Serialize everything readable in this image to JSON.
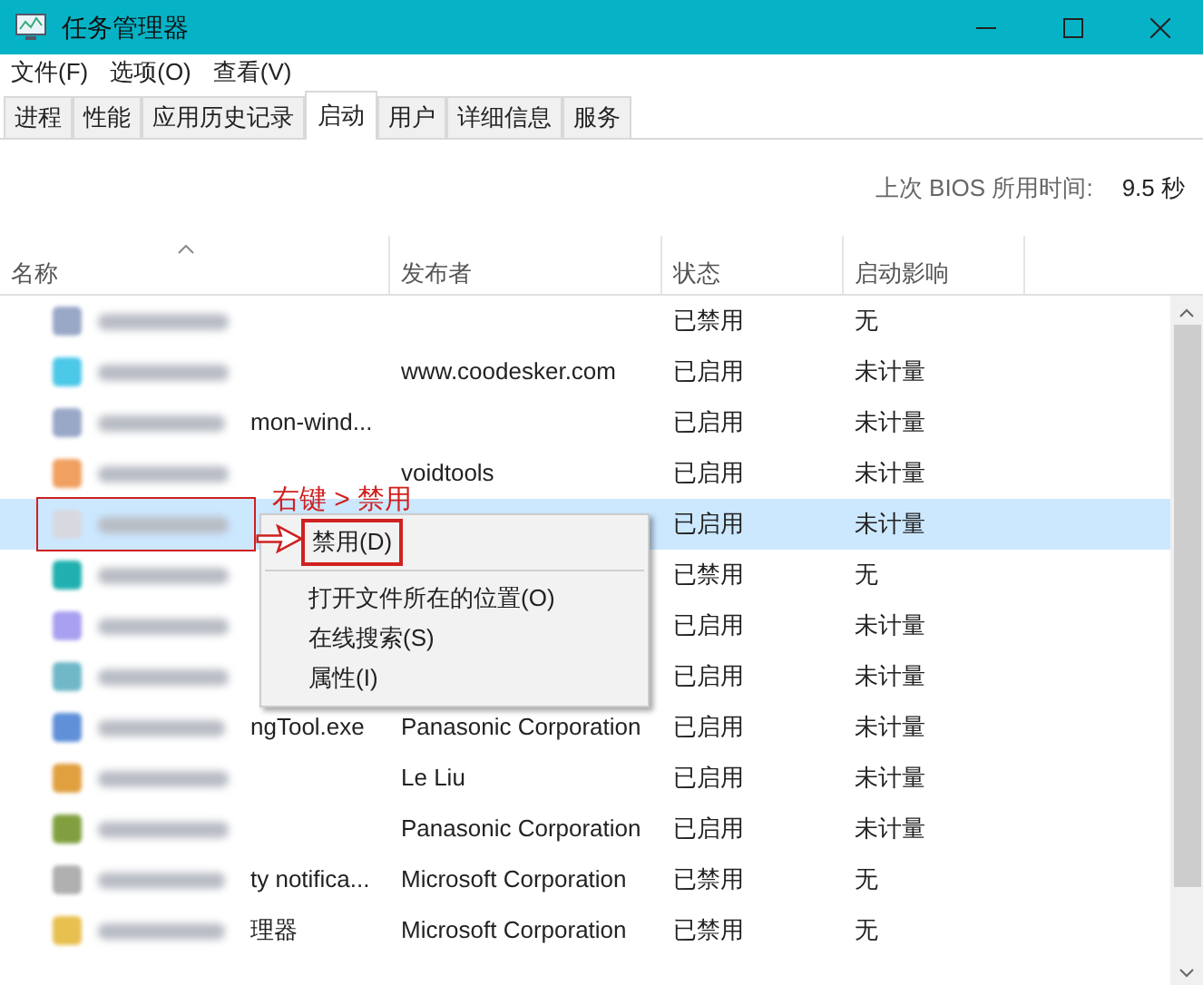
{
  "window": {
    "title": "任务管理器"
  },
  "menu": [
    "文件(F)",
    "选项(O)",
    "查看(V)"
  ],
  "tabs": [
    {
      "label": "进程",
      "selected": false
    },
    {
      "label": "性能",
      "selected": false
    },
    {
      "label": "应用历史记录",
      "selected": false
    },
    {
      "label": "启动",
      "selected": true
    },
    {
      "label": "用户",
      "selected": false
    },
    {
      "label": "详细信息",
      "selected": false
    },
    {
      "label": "服务",
      "selected": false
    }
  ],
  "bios": {
    "label": "上次 BIOS 所用时间:",
    "value": "9.5 秒"
  },
  "table": {
    "columns": [
      "名称",
      "发布者",
      "状态",
      "启动影响"
    ],
    "rows": [
      {
        "color": "#9aa8c8",
        "name_tail": "",
        "publisher": "",
        "status": "已禁用",
        "impact": "无",
        "selected": false
      },
      {
        "color": "#4cc8e8",
        "name_tail": "",
        "publisher": "www.coodesker.com",
        "status": "已启用",
        "impact": "未计量",
        "selected": false
      },
      {
        "color": "#9aa8c8",
        "name_tail": "mon-wind...",
        "publisher": "",
        "status": "已启用",
        "impact": "未计量",
        "selected": false
      },
      {
        "color": "#f0a060",
        "name_tail": "",
        "publisher": "voidtools",
        "status": "已启用",
        "impact": "未计量",
        "selected": false
      },
      {
        "color": "#d8d8e0",
        "name_tail": "",
        "publisher": "",
        "status": "已启用",
        "impact": "未计量",
        "selected": true
      },
      {
        "color": "#20b0b0",
        "name_tail": "",
        "publisher": "",
        "status": "已禁用",
        "impact": "无",
        "selected": false
      },
      {
        "color": "#a8a0f0",
        "name_tail": "",
        "publisher": "",
        "status": "已启用",
        "impact": "未计量",
        "selected": false
      },
      {
        "color": "#70b8c8",
        "name_tail": "",
        "publisher": "",
        "status": "已启用",
        "impact": "未计量",
        "selected": false
      },
      {
        "color": "#6090d8",
        "name_tail": "ngTool.exe",
        "publisher": "Panasonic Corporation",
        "status": "已启用",
        "impact": "未计量",
        "selected": false
      },
      {
        "color": "#e0a040",
        "name_tail": "",
        "publisher": "Le Liu",
        "status": "已启用",
        "impact": "未计量",
        "selected": false
      },
      {
        "color": "#80a040",
        "name_tail": "",
        "publisher": "Panasonic Corporation",
        "status": "已启用",
        "impact": "未计量",
        "selected": false
      },
      {
        "color": "#b0b0b0",
        "name_tail": "ty notifica...",
        "publisher": "Microsoft Corporation",
        "status": "已禁用",
        "impact": "无",
        "selected": false
      },
      {
        "color": "#e8c050",
        "name_tail": "理器",
        "publisher": "Microsoft Corporation",
        "status": "已禁用",
        "impact": "无",
        "selected": false
      }
    ]
  },
  "context_menu": [
    {
      "kind": "item",
      "label": "禁用(D)",
      "highlighted": true
    },
    {
      "kind": "separator"
    },
    {
      "kind": "item",
      "label": "打开文件所在的位置(O)",
      "highlighted": false
    },
    {
      "kind": "item",
      "label": "在线搜索(S)",
      "highlighted": false
    },
    {
      "kind": "item",
      "label": "属性(I)",
      "highlighted": false
    }
  ],
  "annotation": {
    "text": "右键 > 禁用"
  }
}
